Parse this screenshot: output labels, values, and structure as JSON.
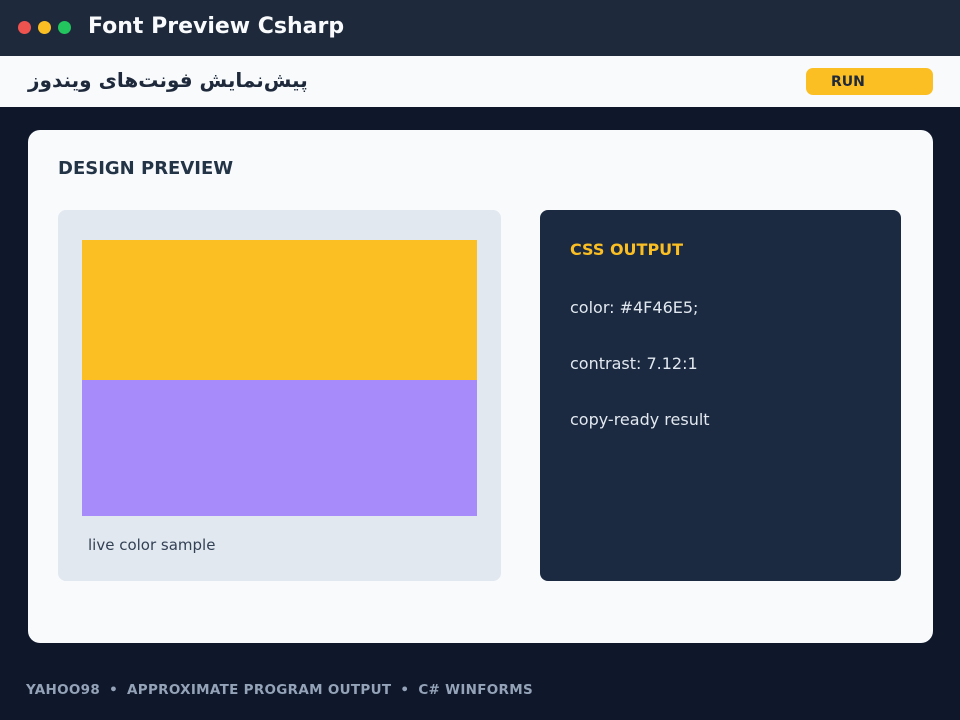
{
  "window": {
    "title": "Font Preview Csharp",
    "controls": [
      "close",
      "minimize",
      "maximize"
    ]
  },
  "toolbar": {
    "subtitle": "پیش‌نمایش فونت‌های ویندوز",
    "run_label": "RUN"
  },
  "main": {
    "section_title": "DESIGN PREVIEW",
    "preview": {
      "caption": "live color sample",
      "swatch_top_color": "#FBBF24",
      "swatch_bottom_color": "#A78BFA"
    },
    "css_output": {
      "title": "CSS OUTPUT",
      "lines": [
        "color: #4F46E5;",
        "contrast: 7.12:1",
        "copy-ready result"
      ]
    }
  },
  "footer": {
    "items": [
      "YAHOO98",
      "APPROXIMATE PROGRAM OUTPUT",
      "C# WINFORMS"
    ],
    "separator": "•"
  },
  "colors": {
    "accent": "#FBBF24",
    "titlebar": "#1E293B",
    "background": "#0F172A",
    "css_panel": "#1B2A40"
  }
}
